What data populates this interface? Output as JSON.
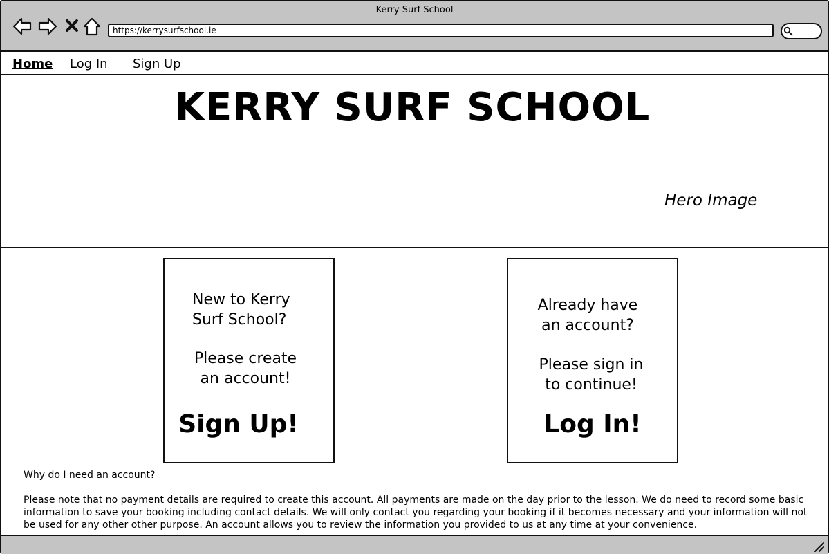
{
  "window": {
    "title": "Kerry Surf School"
  },
  "browser": {
    "url": "https://kerrysurfschool.ie",
    "icons": [
      "back-arrow-icon",
      "forward-arrow-icon",
      "close-icon",
      "home-icon",
      "search-icon",
      "resize-grip-icon"
    ]
  },
  "nav": {
    "home": "Home",
    "login": "Log In",
    "signup": "Sign Up"
  },
  "hero": {
    "title": "KERRY SURF SCHOOL",
    "caption": "Hero Image"
  },
  "cards": {
    "signup": {
      "question_line1": "New to Kerry",
      "question_line2": "Surf School?",
      "prompt_line1": "Please create",
      "prompt_line2": "an account!",
      "cta": "Sign Up!"
    },
    "login": {
      "question_line1": "Already have",
      "question_line2": "an account?",
      "prompt_line1": "Please sign in",
      "prompt_line2": "to continue!",
      "cta": "Log In!"
    }
  },
  "info": {
    "why_link": "Why do I need an account?",
    "notice": "Please note that no payment details are required to create this account. All payments are made on the day prior to the lesson. We do need to record some basic information to save your booking including contact details. We will only contact you regarding your booking if it becomes necessary and your information will not be used for any other other purpose. An account allows you to review the information you provided to us at any time at your convenience."
  },
  "colors": {
    "chrome": "#c4c4c4",
    "border": "#111111",
    "background": "#ffffff"
  }
}
